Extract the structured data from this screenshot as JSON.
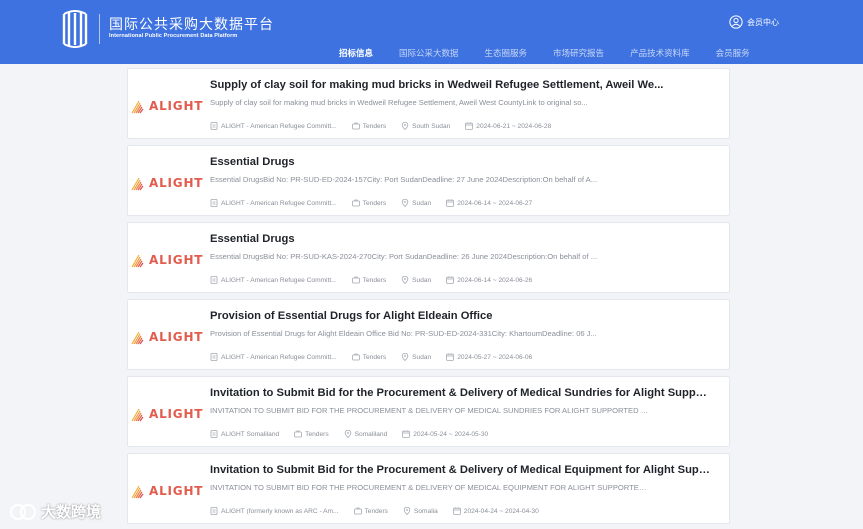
{
  "header": {
    "brand_cn": "国际公共采购大数据平台",
    "brand_en": "International Public Procurement Data Platform",
    "member_center": "会员中心",
    "accent_color": "#3e72e0"
  },
  "nav": {
    "items": [
      {
        "label": "招标信息",
        "active": true
      },
      {
        "label": "国际公采大数据",
        "active": false
      },
      {
        "label": "生态圈服务",
        "active": false
      },
      {
        "label": "市场研究报告",
        "active": false
      },
      {
        "label": "产品技术资料库",
        "active": false
      },
      {
        "label": "会员服务",
        "active": false
      }
    ]
  },
  "logo_text": "ALIGHT",
  "cards": [
    {
      "title": "Supply of clay soil for making mud bricks in Wedweil Refugee Settlement, Aweil We...",
      "desc": "Supply of clay soil for making mud bricks in Wedweil Refugee Settlement, Aweil West CountyLink to original so...",
      "org": "ALIGHT - American Refugee Committ...",
      "type": "Tenders",
      "location": "South Sudan",
      "dates": "2024-06-21 ~ 2024-06-28"
    },
    {
      "title": "Essential Drugs",
      "desc": "Essential DrugsBid No: PR-SUD-ED-2024-157City: Port SudanDeadline: 27 June 2024Description:On behalf of A...",
      "org": "ALIGHT - American Refugee Committ...",
      "type": "Tenders",
      "location": "Sudan",
      "dates": "2024-06-14 ~ 2024-06-27"
    },
    {
      "title": "Essential Drugs",
      "desc": "Essential DrugsBid No: PR-SUD-KAS-2024-270City: Port SudanDeadline: 26 June 2024Description:On behalf of ...",
      "org": "ALIGHT - American Refugee Committ...",
      "type": "Tenders",
      "location": "Sudan",
      "dates": "2024-06-14 ~ 2024-06-26"
    },
    {
      "title": "Provision of Essential Drugs for Alight Eldeain Office",
      "desc": "Provision of Essential Drugs for Alight Eldeain Office Bid No: PR-SUD-ED-2024-331City: KhartoumDeadline: 06 J...",
      "org": "ALIGHT - American Refugee Committ...",
      "type": "Tenders",
      "location": "Sudan",
      "dates": "2024-05-27 ~ 2024-06-06"
    },
    {
      "title": "Invitation to Submit Bid for the Procurement & Delivery of Medical Sundries for Alight Support...",
      "desc": "INVITATION TO SUBMIT BID FOR THE PROCUREMENT & DELIVERY OF MEDICAL SUNDRIES FOR ALIGHT SUPPORTED HEALTH F...",
      "org": "ALIGHT Somaliland",
      "type": "Tenders",
      "location": "Somaliland",
      "dates": "2024-05-24 ~ 2024-05-30"
    },
    {
      "title": "Invitation to Submit Bid for the Procurement & Delivery of Medical Equipment for Alight Suppo...",
      "desc": "INVITATION TO SUBMIT BID FOR THE PROCUREMENT & DELIVERY OF MEDICAL EQUIPMENT FOR ALIGHT SUPPORTED HEALTH...",
      "org": "ALIGHT (formerly known as ARC - Am...",
      "type": "Tenders",
      "location": "Somalia",
      "dates": "2024-04-24 ~ 2024-04-30"
    }
  ],
  "watermark": "大数跨境"
}
